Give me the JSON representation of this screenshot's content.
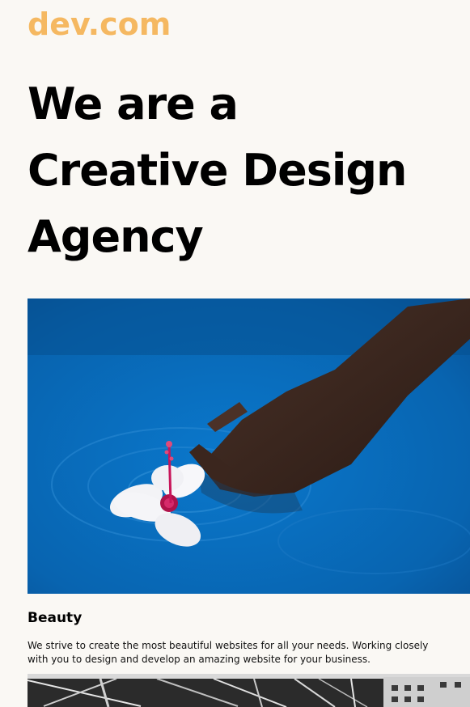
{
  "header": {
    "logo_text": "dev.com"
  },
  "hero": {
    "title_lines": [
      "We are a",
      "Creative Design",
      "Agency"
    ],
    "image_name": "hibiscus-flower-in-pool-photo"
  },
  "features": {
    "items": [
      {
        "title": "Beauty",
        "description": "We strive to create the most beautiful websites for all your needs. Working closely with you to design and develop an amazing website for your business."
      }
    ]
  },
  "gallery": {
    "image_name": "steel-structure-photo"
  },
  "colors": {
    "background": "#faf8f4",
    "logo": "#f5b861",
    "text": "#000000",
    "water": "#0a6fc0"
  }
}
